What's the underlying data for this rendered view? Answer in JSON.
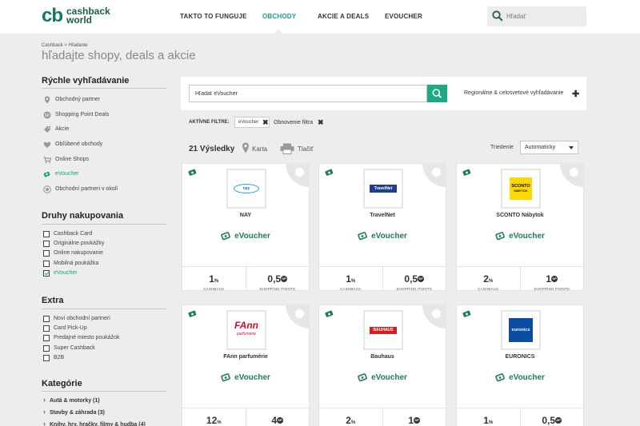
{
  "header": {
    "logo_mark": "cb",
    "logo_line1": "cashback",
    "logo_line2": "world",
    "nav": [
      "TAKTO TO FUNGUJE",
      "OBCHODY",
      "AKCIE A DEALS",
      "EVOUCHER"
    ],
    "search_placeholder": "Hľadať"
  },
  "breadcrumb": "Cashback > Hľadanie",
  "page_title": "hľadajte shopy, deals a akcie",
  "sidebar": {
    "quick_title": "Rýchle vyhľadávanie",
    "quick_items": [
      "Obchodný partner",
      "Shopping Point Deals",
      "Akcie",
      "Obľúbené obchody",
      "Online Shops",
      "eVoucher",
      "Obchodní partneri v okolí"
    ],
    "shop_title": "Druhy nakupovania",
    "shop_items": [
      "Cashback Card",
      "Originálne poukážky",
      "Online nakupovanie",
      "Mobilná poukážka",
      "eVoucher"
    ],
    "extra_title": "Extra",
    "extra_items": [
      "Noví obchodní partneri",
      "Card Pick-Up",
      "Predajné miesto poukážok",
      "Super Cashback",
      "B2B"
    ],
    "cat_title": "Kategórie",
    "cat_items": [
      "Autá & motorky (1)",
      "Stavby & záhrada (3)",
      "Knihy, hry, hračky, filmy & hudba (4)"
    ]
  },
  "main": {
    "search_value": "Hľadať eVoucher",
    "regional": "Regionálne & celosvetové vyhľadávanie",
    "filters_label": "AKTÍVNE FILTRE:",
    "chip": "eVoucher",
    "reset": "Obnovenie filtra",
    "results": "21 Výsledky",
    "map": "Karta",
    "print": "Tlačiť",
    "sort_label": "Triedenie",
    "sort_value": "Automaticky"
  },
  "cards": [
    {
      "name": "NAY",
      "logo": "nay",
      "type": "eVoucher",
      "cashback": "1",
      "cashback_unit": "%",
      "cashback_cap": "CASHBACK",
      "points": "0,5",
      "points_cap": "SHOPPING POINTS"
    },
    {
      "name": "TravelNet",
      "logo": "TravelNet",
      "type": "eVoucher",
      "cashback": "1",
      "cashback_unit": "%",
      "cashback_cap": "CASHBACK",
      "points": "0,5",
      "points_cap": "SHOPPING POINTS"
    },
    {
      "name": "SCONTO Nábytok",
      "logo": "SCONTO",
      "logo2": "NÁBYTOK",
      "type": "eVoucher",
      "cashback": "2",
      "cashback_unit": "%",
      "cashback_cap": "CASHBACK",
      "points": "1",
      "points_cap": "SHOPPING POINTS"
    },
    {
      "name": "FAnn parfumérie",
      "logo": "FAnn",
      "logo2": "parfumérie",
      "type": "eVoucher",
      "cashback": "12",
      "cashback_unit": "%",
      "points": "4"
    },
    {
      "name": "Bauhaus",
      "logo": "BAUHAUS",
      "type": "eVoucher",
      "cashback": "2",
      "cashback_unit": "%",
      "points": "1"
    },
    {
      "name": "EURONICS",
      "logo": "euronics",
      "type": "eVoucher",
      "cashback": "1",
      "cashback_unit": "%",
      "points": "0,5"
    }
  ],
  "sp_badge": "SP",
  "colors": {
    "accent": "#14a37f",
    "dark_green": "#1e7b62",
    "bg": "#ededed"
  }
}
